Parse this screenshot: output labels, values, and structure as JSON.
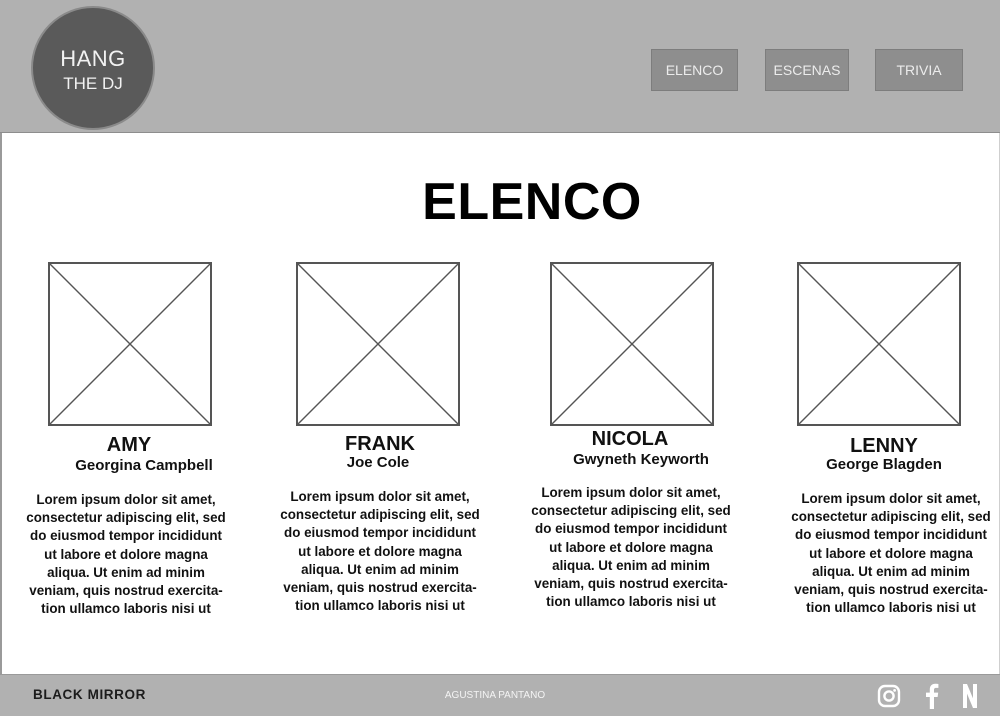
{
  "header": {
    "logo": {
      "line1": "HANG",
      "line2": "THE DJ"
    },
    "nav": [
      {
        "label": "ELENCO"
      },
      {
        "label": "ESCENAS"
      },
      {
        "label": "TRIVIA"
      }
    ]
  },
  "main": {
    "title": "ELENCO",
    "cast": [
      {
        "name": "AMY",
        "actor": "Georgina Campbell",
        "description_lines": [
          "Lorem ipsum dolor sit amet,",
          "consectetur adipiscing elit, sed",
          "do eiusmod tempor incididunt",
          "ut labore et dolore magna",
          "aliqua. Ut enim ad minim",
          "veniam, quis nostrud exercita-",
          "tion ullamco laboris nisi ut"
        ]
      },
      {
        "name": "FRANK",
        "actor": "Joe Cole",
        "description_lines": [
          "Lorem ipsum dolor sit amet,",
          "consectetur adipiscing elit, sed",
          "do eiusmod tempor incididunt",
          "ut labore et dolore magna",
          "aliqua. Ut enim ad minim",
          "veniam, quis nostrud exercita-",
          "tion ullamco laboris nisi ut"
        ]
      },
      {
        "name": "NICOLA",
        "actor": "Gwyneth Keyworth",
        "description_lines": [
          "Lorem ipsum dolor sit amet,",
          "consectetur adipiscing elit, sed",
          "do eiusmod tempor incididunt",
          "ut labore et dolore magna",
          "aliqua. Ut enim ad minim",
          "veniam, quis nostrud exercita-",
          "tion ullamco laboris nisi ut"
        ]
      },
      {
        "name": "LENNY",
        "actor": "George Blagden",
        "description_lines": [
          "Lorem ipsum dolor sit amet,",
          "consectetur adipiscing elit, sed",
          "do eiusmod tempor incididunt",
          "ut labore et dolore magna",
          "aliqua. Ut enim ad minim",
          "veniam, quis nostrud exercita-",
          "tion ullamco laboris nisi ut"
        ]
      }
    ]
  },
  "footer": {
    "brand": "BLACK MIRROR",
    "credit": "AGUSTINA PANTANO",
    "social": [
      {
        "icon": "instagram-icon"
      },
      {
        "icon": "facebook-icon"
      },
      {
        "icon": "netflix-icon"
      }
    ]
  },
  "colors": {
    "header_bg": "#b1b1b1",
    "logo_bg": "#5a5a5a",
    "nav_button_bg": "#8e8e8e",
    "footer_bg": "#b1b1b1"
  }
}
